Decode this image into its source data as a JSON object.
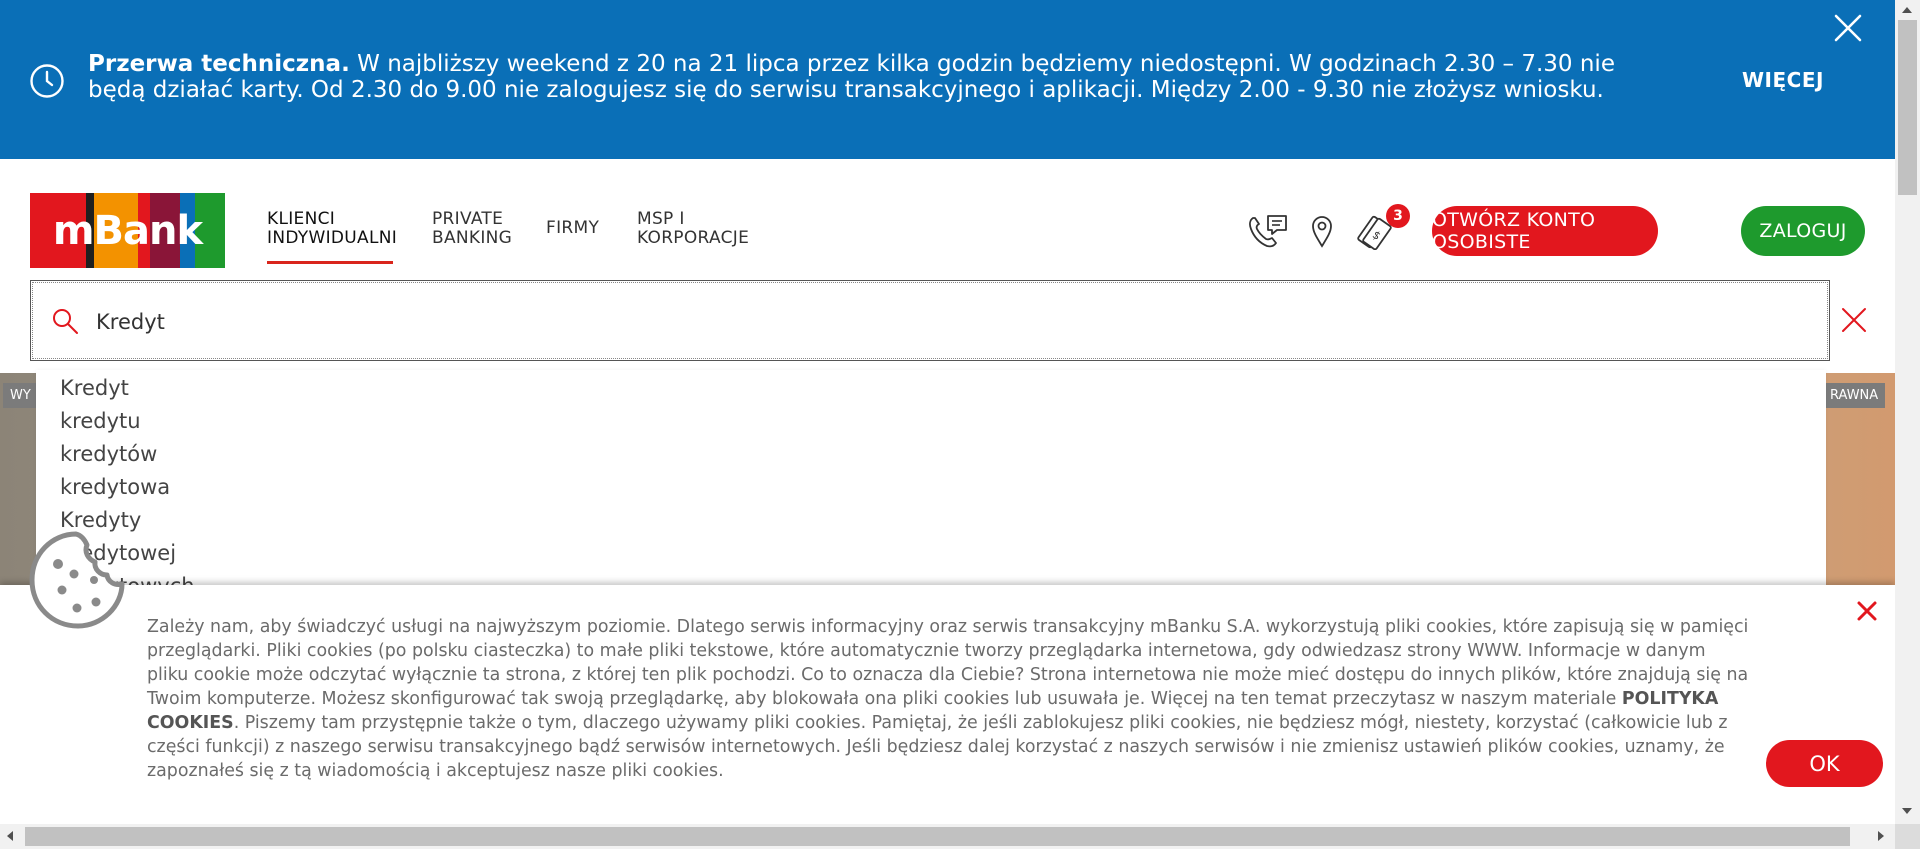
{
  "notice": {
    "title": "Przerwa techniczna.",
    "message": " W najbliższy weekend z 20 na 21 lipca przez kilka godzin będziemy niedostępni. W godzinach 2.30 – 7.30 nie będą działać karty. Od 2.30 do 9.00 nie zalogujesz się do serwisu transakcyjnego i aplikacji. Między 2.00 - 9.30 nie złożysz wniosku.",
    "more_label": "WIĘCEJ",
    "icon": "clock-icon",
    "close_icon": "close-icon"
  },
  "header": {
    "logo_text": "mBank",
    "logo_colors": [
      "#e2171e",
      "#1f1f1f",
      "#f39200",
      "#e2171e",
      "#8a1538",
      "#0a6fb7",
      "#1e9a2d"
    ],
    "nav": [
      {
        "line1": "KLIENCI",
        "line2": "INDYWIDUALNI",
        "active": true
      },
      {
        "line1": "PRIVATE",
        "line2": "BANKING",
        "active": false
      },
      {
        "line1": "FIRMY",
        "line2": "",
        "active": false
      },
      {
        "line1": "MSP I",
        "line2": "KORPORACJE",
        "active": false
      }
    ],
    "icons": [
      "phone-chat-icon",
      "location-pin-icon",
      "tag-notification-icon"
    ],
    "badge_count": "3",
    "open_account_label": "OTWÓRZ KONTO OSOBISTE",
    "login_label": "ZALOGUJ"
  },
  "search": {
    "value": "Kredyt",
    "suggestions": [
      "Kredyt",
      "kredytu",
      "kredytów",
      "kredytowa",
      "Kredyty",
      "kredytowej",
      "kredytowych"
    ]
  },
  "hero": {
    "left_tag": "WY",
    "right_tag": "RAWNA"
  },
  "cookie": {
    "text_before": "Zależy nam, aby świadczyć usługi na najwyższym poziomie. Dlatego serwis informacyjny oraz serwis transakcyjny mBanku S.A. wykorzystują pliki cookies, które zapisują się w pamięci przeglądarki. Pliki cookies (po polsku ciasteczka) to małe pliki tekstowe, które automatycznie tworzy przeglądarka internetowa, gdy odwiedzasz strony WWW. Informacje w danym pliku cookie może odczytać wyłącznie ta strona, z której ten plik pochodzi. Co to oznacza dla Ciebie? Strona internetowa nie może mieć dostępu do innych plików, które znajdują się na Twoim komputerze. Możesz skonfigurować tak swoją przeglądarkę, aby blokowała ona pliki cookies lub usuwała je. Więcej na ten temat przeczytasz w naszym materiale ",
    "link_label": "POLITYKA COOKIES",
    "text_after": ". Piszemy tam przystępnie także o tym, dlaczego używamy pliki cookies. Pamiętaj, że jeśli zablokujesz pliki cookies, nie będziesz mógł, niestety, korzystać (całkowicie lub z części funkcji) z naszego serwisu transakcyjnego bądź serwisów internetowych. Jeśli będziesz dalej korzystać z naszych serwisów i nie zmienisz ustawień plików cookies, uznamy, że zapoznałeś się z tą wiadomością i akceptujesz nasze pliki cookies.",
    "ok_label": "OK",
    "icon": "cookie-icon"
  }
}
